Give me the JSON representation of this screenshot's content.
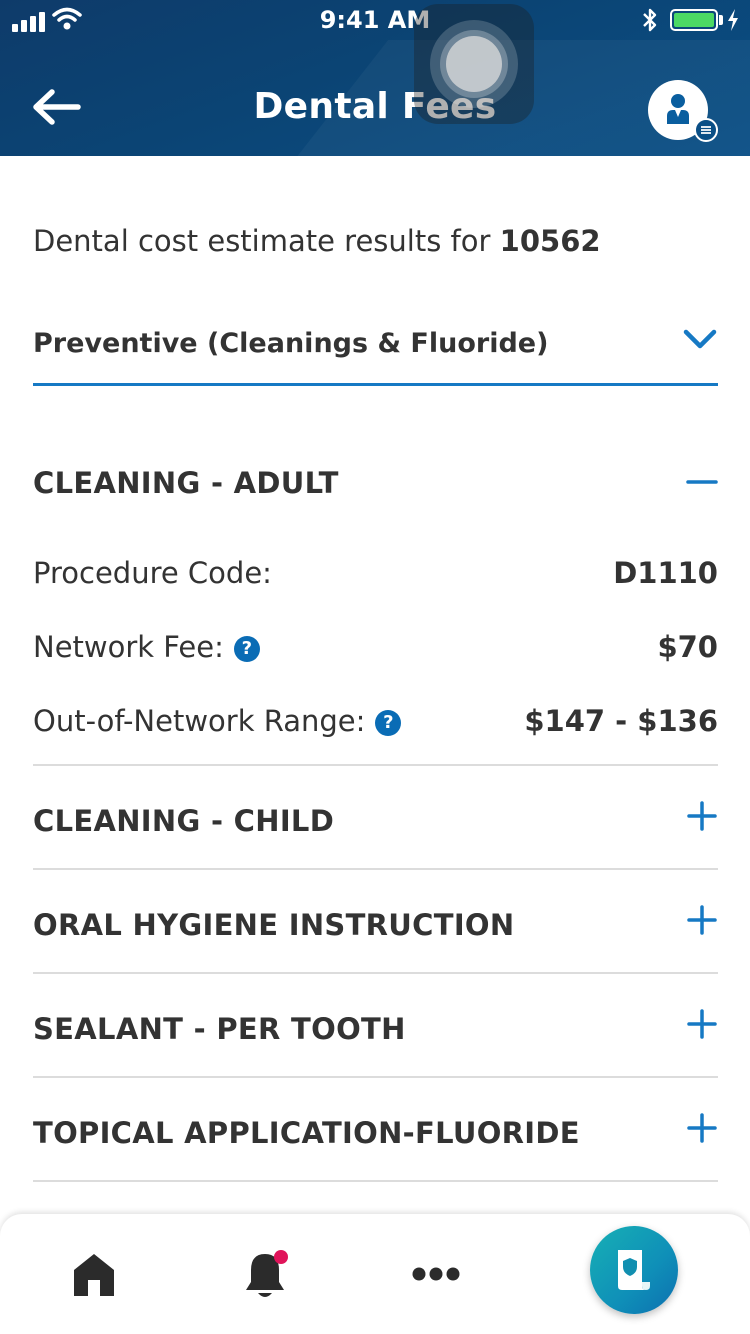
{
  "status_bar": {
    "time": "9:41 AM"
  },
  "header": {
    "title": "Dental Fees"
  },
  "intro": {
    "prefix": "Dental cost estimate results for",
    "zip": "10562"
  },
  "category": {
    "label": "Preventive (Cleanings & Fluoride)"
  },
  "procedures": [
    {
      "title": "CLEANING - ADULT",
      "expanded": true
    },
    {
      "title": "CLEANING - CHILD",
      "expanded": false
    },
    {
      "title": "ORAL HYGIENE INSTRUCTION",
      "expanded": false
    },
    {
      "title": "SEALANT - PER TOOTH",
      "expanded": false
    },
    {
      "title": "TOPICAL APPLICATION-FLUORIDE",
      "expanded": false
    }
  ],
  "details": {
    "procedure_code_label": "Procedure Code:",
    "procedure_code_value": "D1110",
    "network_fee_label": "Network Fee:",
    "network_fee_value": "$70",
    "out_of_network_label": "Out-of-Network Range:",
    "out_of_network_value": "$147 - $136",
    "help_glyph": "?"
  },
  "tabbar": {
    "items": [
      "home-icon",
      "bell-icon",
      "more-icon",
      "id-card-icon"
    ]
  },
  "colors": {
    "header_bg": "#0b4474",
    "accent": "#1679c4",
    "help_bg": "#0a6cb5",
    "notification": "#e0145a",
    "fab": "#17b0b5"
  }
}
